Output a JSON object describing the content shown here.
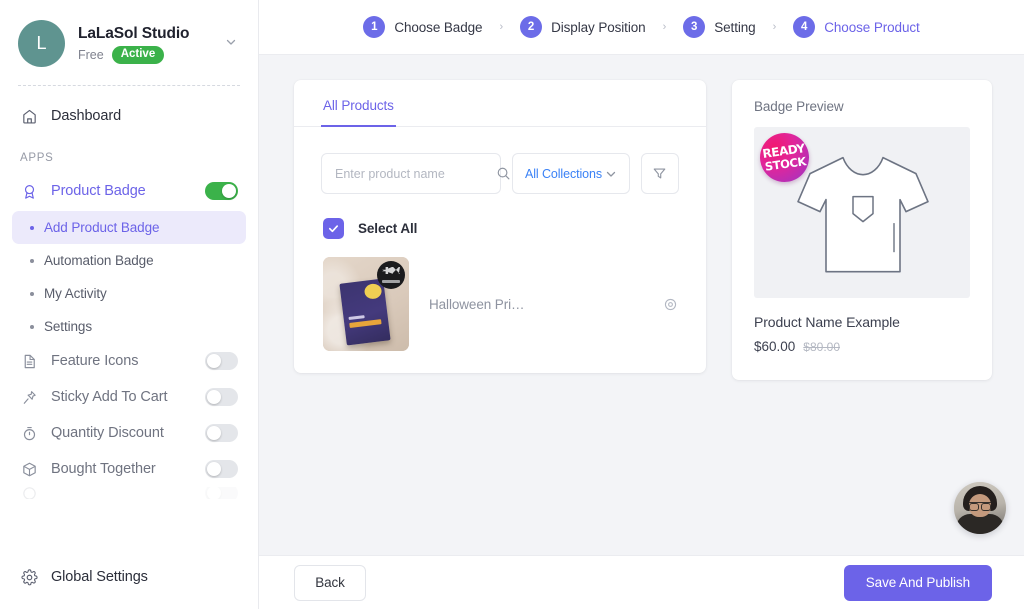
{
  "sidebar": {
    "account": {
      "avatar_initial": "L",
      "name": "LaLaSol Studio",
      "plan": "Free",
      "status_badge": "Active",
      "chevron_icon": "chevron-down-icon"
    },
    "dashboard": {
      "label": "Dashboard",
      "icon": "home-icon"
    },
    "section_title": "APPS",
    "product_badge": {
      "label": "Product Badge",
      "icon": "badge-icon",
      "toggle_on": true,
      "sub_items": [
        {
          "label": "Add Product Badge",
          "active": true
        },
        {
          "label": "Automation Badge",
          "active": false
        },
        {
          "label": "My Activity",
          "active": false
        },
        {
          "label": "Settings",
          "active": false
        }
      ]
    },
    "apps": [
      {
        "label": "Feature Icons",
        "icon": "document-icon",
        "toggle_on": false
      },
      {
        "label": "Sticky Add To Cart",
        "icon": "pin-icon",
        "toggle_on": false
      },
      {
        "label": "Quantity Discount",
        "icon": "timer-icon",
        "toggle_on": false
      },
      {
        "label": "Bought Together",
        "icon": "box-icon",
        "toggle_on": false
      }
    ],
    "global_settings": {
      "label": "Global Settings",
      "icon": "gear-icon"
    }
  },
  "stepper": {
    "steps": [
      {
        "num": "1",
        "label": "Choose Badge",
        "active": false
      },
      {
        "num": "2",
        "label": "Display Position",
        "active": false
      },
      {
        "num": "3",
        "label": "Setting",
        "active": false
      },
      {
        "num": "4",
        "label": "Choose Product",
        "active": true
      }
    ],
    "separator": "›"
  },
  "products_card": {
    "tab_label": "All Products",
    "search": {
      "placeholder": "Enter product name",
      "value": "",
      "icon": "search-icon"
    },
    "collections_select": {
      "value": "All Collections",
      "icon": "chevron-down-icon"
    },
    "filter_button": {
      "icon": "filter-icon"
    },
    "select_all": {
      "label": "Select All",
      "checked": true,
      "icon": "check-icon"
    },
    "rows": [
      {
        "name": "Halloween Pri…",
        "view_icon": "eye-icon"
      }
    ]
  },
  "preview_card": {
    "title": "Badge Preview",
    "badge": {
      "line1": "READY",
      "line2": "STOCK"
    },
    "product_name": "Product Name Example",
    "price_current": "$60.00",
    "price_original": "$80.00",
    "shirt_icon": "tshirt-icon"
  },
  "footer": {
    "back_label": "Back",
    "publish_label": "Save And Publish"
  },
  "support_widget": {
    "icon": "support-avatar-icon"
  },
  "colors": {
    "accent_purple": "#6c63e8",
    "step_circle": "#6c6ce8",
    "link_blue": "#3b82f6",
    "toggle_on_green": "#3bb24a",
    "status_badge_green": "#3bb24a",
    "page_background": "#f3f4f7",
    "badge_gradient_from": "#f2186f",
    "badge_gradient_to": "#9b34c7"
  }
}
